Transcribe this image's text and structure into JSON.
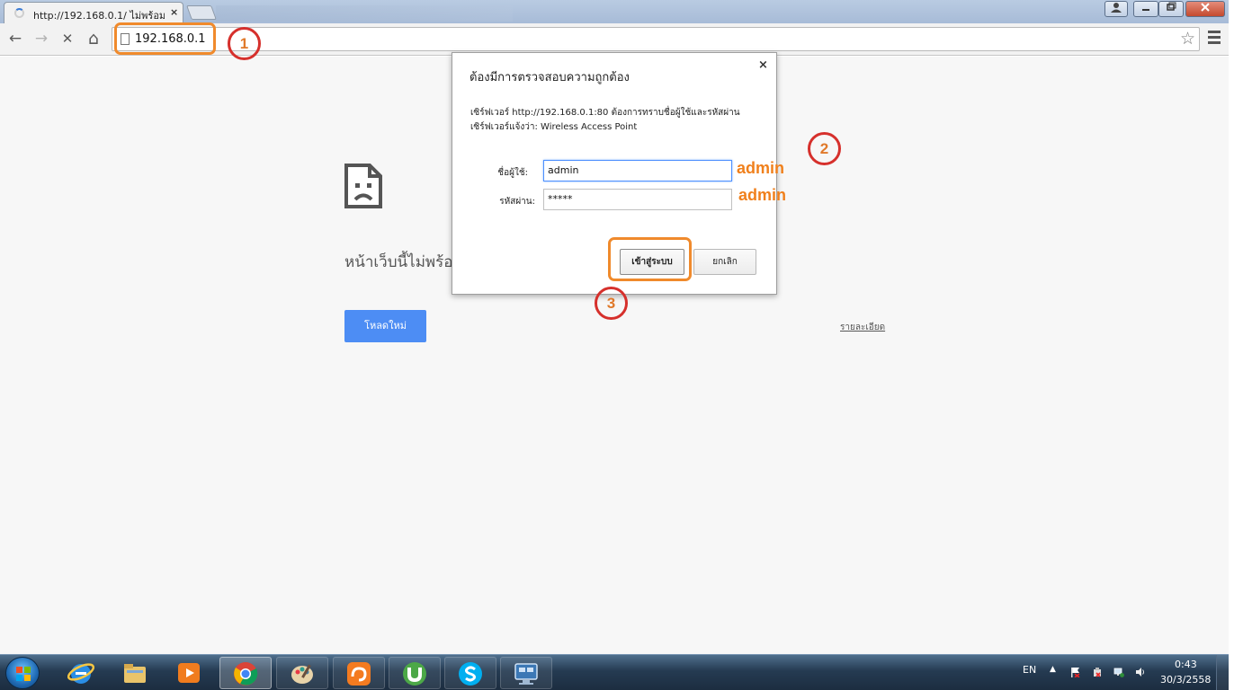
{
  "browser": {
    "tab_title": "http://192.168.0.1/ ไม่พร้อม",
    "tab_close": "×",
    "url": "192.168.0.1",
    "window_controls": [
      "profile-icon",
      "minimize-icon",
      "restore-icon",
      "close-icon"
    ]
  },
  "toolbar": {
    "back": "←",
    "forward": "→",
    "stop": "✕",
    "home": "⌂",
    "star": "☆"
  },
  "error_page": {
    "title": "หน้าเว็บนี้ไม่พร้อ",
    "reload_button": "โหลดใหม่",
    "details_link": "รายละเอียด"
  },
  "auth_dialog": {
    "title": "ต้องมีการตรวจสอบความถูกต้อง",
    "close": "×",
    "message_line1": "เซิร์ฟเวอร์ http://192.168.0.1:80 ต้องการทราบชื่อผู้ใช้และรหัสผ่าน",
    "message_line2": "เซิร์ฟเวอร์แจ้งว่า: Wireless Access Point",
    "username_label": "ชื่อผู้ใช้:",
    "username_value": "admin",
    "password_label": "รหัสผ่าน:",
    "password_value": "*****",
    "login_button": "เข้าสู่ระบบ",
    "cancel_button": "ยกเลิก"
  },
  "annotations": {
    "step1": "1",
    "step2": "2",
    "step3": "3",
    "username_hint": "admin",
    "password_hint": "admin",
    "highlight_color": "#f08a2c",
    "circle_color": "#d6302c"
  },
  "taskbar": {
    "apps": [
      "internet-explorer-icon",
      "file-explorer-icon",
      "media-player-icon",
      "chrome-icon",
      "paint-icon",
      "uc-browser-icon",
      "utorrent-icon",
      "skype-icon",
      "remote-desktop-icon"
    ],
    "language": "EN",
    "time": "0:43",
    "date": "30/3/2558"
  }
}
